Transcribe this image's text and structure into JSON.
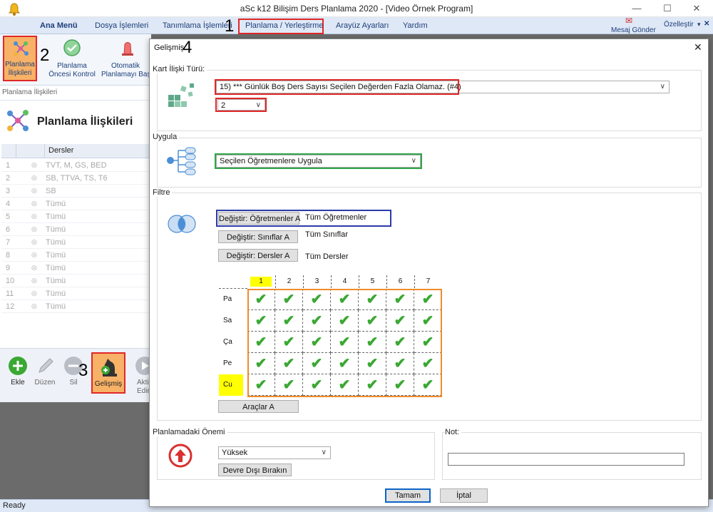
{
  "window": {
    "title": "aSc k12 Bilişim Ders Planlama 2020  - [Video Örnek Program]",
    "minimize": "—",
    "maximize": "☐",
    "close": "✕"
  },
  "menu": {
    "items": [
      "Ana Menü",
      "Dosya İşlemleri",
      "Tanımlama İşlemleri",
      "Planlama / Yerleştirme",
      "Arayüz Ayarları",
      "Yardım"
    ],
    "message_send": "Mesaj Gönder",
    "customize": "Özelleştir",
    "customize_arrow": "▾",
    "close_x": "✕"
  },
  "annotations": {
    "n1": "1",
    "n2": "2",
    "n3": "3",
    "n4": "4"
  },
  "ribbon": {
    "relations": [
      "Planlama",
      "İlişkileri"
    ],
    "precheck": [
      "Planlama",
      "Öncesi Kontrol"
    ],
    "auto": [
      "Otomatik",
      "Planlamayı Başl"
    ]
  },
  "left": {
    "breadcrumb": "Planlama İlişkileri",
    "heading": "Planlama İlişkileri",
    "column": "Dersler",
    "rows": [
      {
        "n": "1",
        "t": "TVT, M, GS, BED"
      },
      {
        "n": "2",
        "t": "SB, TTVA, TS, T6"
      },
      {
        "n": "3",
        "t": "SB"
      },
      {
        "n": "4",
        "t": "Tümü"
      },
      {
        "n": "5",
        "t": "Tümü"
      },
      {
        "n": "6",
        "t": "Tümü"
      },
      {
        "n": "7",
        "t": "Tümü"
      },
      {
        "n": "8",
        "t": "Tümü"
      },
      {
        "n": "9",
        "t": "Tümü"
      },
      {
        "n": "10",
        "t": "Tümü"
      },
      {
        "n": "11",
        "t": "Tümü"
      },
      {
        "n": "12",
        "t": "Tümü"
      }
    ],
    "tools": {
      "add": "Ekle",
      "edit": "Düzen",
      "delete": "Sil",
      "advanced": "Gelişmiş",
      "activate": [
        "Akti",
        "Edin"
      ]
    }
  },
  "status": {
    "text": "Ready"
  },
  "dialog": {
    "title": "Gelişmiş",
    "close": "✕",
    "card_relation": {
      "label": "Kart İlişki Türü:",
      "selected": "15) *** Günlük Boş Ders Sayısı Seçilen Değerden Fazla Olamaz. (#4)",
      "value": "2"
    },
    "apply": {
      "label": "Uygula",
      "selected": "Seçilen Öğretmenlere Uygula"
    },
    "filter": {
      "label": "Filtre",
      "buttons": [
        "Değiştir: Öğretmenler A",
        "Değiştir: Sınıflar A",
        "Değiştir: Dersler A"
      ],
      "values": [
        "Tüm Öğretmenler",
        "Tüm Sınıflar",
        "Tüm Dersler"
      ],
      "periods": [
        "1",
        "2",
        "3",
        "4",
        "5",
        "6",
        "7"
      ],
      "days": [
        "Pa",
        "Sa",
        "Ça",
        "Pe",
        "Cu"
      ],
      "checkmark": "✔",
      "all_checked": true,
      "highlight_color": "#ffff00",
      "tools_button": "Araçlar A"
    },
    "importance": {
      "label": "Planlamadaki Önemi",
      "selected": "Yüksek",
      "disable_button": "Devre Dışı Bırakın"
    },
    "note": {
      "label": "Not:",
      "value": ""
    },
    "ok": "Tamam",
    "cancel": "İptal"
  },
  "colors": {
    "highlight_red": "#e02828",
    "highlight_blue": "#2b3ba8",
    "highlight_green": "#2fa64a",
    "highlight_orange": "#f08c2c",
    "check_green": "#3aa832",
    "menu_text": "#1d3f7a"
  }
}
